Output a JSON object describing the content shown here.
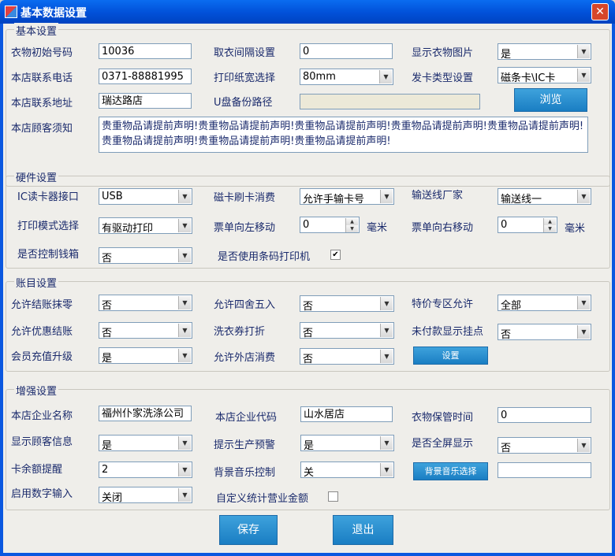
{
  "window": {
    "title": "基本数据设置",
    "close_glyph": "✕"
  },
  "basic": {
    "legend": "基本设置",
    "cloth_start_label": "衣物初始号码",
    "cloth_start_value": "10036",
    "interval_label": "取衣间隔设置",
    "interval_value": "0",
    "show_image_label": "显示衣物图片",
    "show_image_value": "是",
    "phone_label": "本店联系电话",
    "phone_value": "0371-88881995",
    "paper_label": "打印纸宽选择",
    "paper_value": "80mm",
    "card_type_label": "发卡类型设置",
    "card_type_value": "磁条卡\\IC卡",
    "address_label": "本店联系地址",
    "address_value": "瑞达路店",
    "usb_backup_label": "U盘备份路径",
    "usb_backup_value": "",
    "browse_button": "浏览",
    "notice_label": "本店顾客须知",
    "notice_value": "贵重物品请提前声明!贵重物品请提前声明!贵重物品请提前声明!贵重物品请提前声明!贵重物品请提前声明!贵重物品请提前声明!贵重物品请提前声明!贵重物品请提前声明!"
  },
  "hardware": {
    "legend": "硬件设置",
    "ic_reader_label": "IC读卡器接口",
    "ic_reader_value": "USB",
    "mag_card_label": "磁卡刷卡消费",
    "mag_card_value": "允许手输卡号",
    "conveyor_label": "输送线厂家",
    "conveyor_value": "输送线一",
    "print_mode_label": "打印模式选择",
    "print_mode_value": "有驱动打印",
    "move_left_label": "票单向左移动",
    "move_left_value": "0",
    "move_left_unit": "毫米",
    "move_right_label": "票单向右移动",
    "move_right_value": "0",
    "move_right_unit": "毫米",
    "cash_drawer_label": "是否控制钱箱",
    "cash_drawer_value": "否",
    "barcode_printer_label": "是否使用条码打印机",
    "barcode_printer_checked": "✔"
  },
  "account": {
    "legend": "账目设置",
    "allow_zero_label": "允许结账抹零",
    "allow_zero_value": "否",
    "rounding_label": "允许四舍五入",
    "rounding_value": "否",
    "special_label": "特价专区允许",
    "special_value": "全部",
    "discount_label": "允许优惠结账",
    "discount_value": "否",
    "coupon_label": "洗衣券打折",
    "coupon_value": "否",
    "unpaid_label": "未付款显示挂点",
    "unpaid_value": "否",
    "recharge_label": "会员充值升级",
    "recharge_value": "是",
    "outside_label": "允许外店消费",
    "outside_value": "否",
    "settings_button": "设置"
  },
  "enhanced": {
    "legend": "增强设置",
    "company_name_label": "本店企业名称",
    "company_name_value": "福州仆家洗涤公司",
    "company_code_label": "本店企业代码",
    "company_code_value": "山水居店",
    "storage_time_label": "衣物保管时间",
    "storage_time_value": "0",
    "customer_info_label": "显示顾客信息",
    "customer_info_value": "是",
    "warning_label": "提示生产预警",
    "warning_value": "是",
    "fullscreen_label": "是否全屏显示",
    "fullscreen_value": "否",
    "balance_label": "卡余额提醒",
    "balance_value": "2",
    "music_label": "背景音乐控制",
    "music_value": "关",
    "music_button": "背景音乐选择",
    "music_path_value": "",
    "numeric_label": "启用数字输入",
    "numeric_value": "关闭",
    "custom_stats_label": "自定义统计营业金额",
    "custom_stats_checked": ""
  },
  "footer": {
    "save_button": "保存",
    "exit_button": "退出"
  }
}
